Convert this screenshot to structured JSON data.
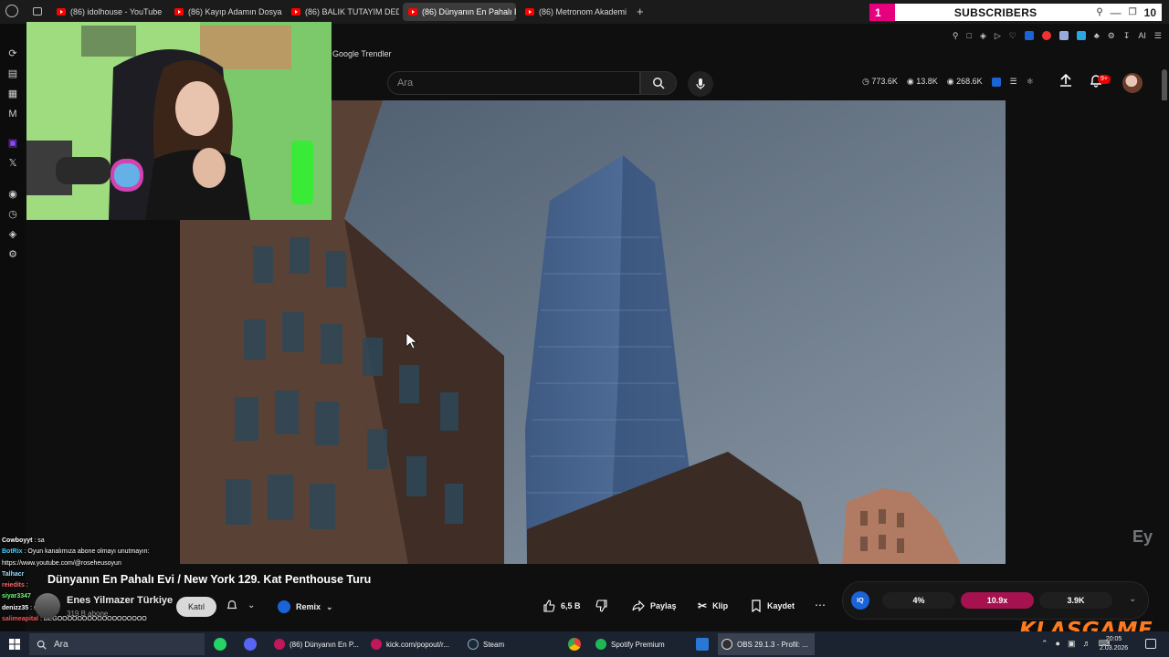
{
  "browser": {
    "tabs": [
      {
        "label": "(86) idolhouse - YouTube"
      },
      {
        "label": "(86) Kayıp Adamın Dosyası"
      },
      {
        "label": "(86) BALIK TUTAYIM DEDİ"
      },
      {
        "label": "(86) Dünyanın En Pahalı E"
      },
      {
        "label": "(86) Metronom Akademi"
      }
    ],
    "new_tab": "+"
  },
  "subscribers_widget": {
    "count": "1",
    "label": "SUBSCRIBERS",
    "right_value": "10"
  },
  "youtube": {
    "trendler": "Google Trendler",
    "search_placeholder": "Ara",
    "stats": [
      "773.6K",
      "13.8K",
      "268.6K"
    ],
    "notifications_badge": "9+"
  },
  "chat": [
    {
      "user": "Cowboyyt",
      "text": " : sa"
    },
    {
      "user": "BotRix",
      "text": " : Oyun kanalımıza abone olmayı unutmayın:"
    },
    {
      "user": "",
      "text": "https://www.youtube.com/@roseheusoyun"
    },
    {
      "user": "Talhacr",
      "text": ""
    },
    {
      "user": "reiedits",
      "text": " :"
    },
    {
      "user": "siyar3347",
      "text": ""
    },
    {
      "user": "denizz35",
      "text": " : sa"
    },
    {
      "user": "salimeapital",
      "text": " : BEGOOOOOOOOOOOOOOOOOO"
    }
  ],
  "video": {
    "title": "Dünyanın En Pahalı Evi / New York 129. Kat Penthouse Turu",
    "watermark": "Ey"
  },
  "channel": {
    "name": "Enes Yilmazer Türkiye",
    "subs": "319 B abone",
    "join": "Katıl",
    "remix": "Remix"
  },
  "actions": {
    "likes": "6,5 B",
    "share": "Paylaş",
    "clip": "Klip",
    "save": "Kaydet"
  },
  "stats_widget": {
    "badge": "IQ",
    "percent": "4%",
    "multiplier": "10.9x",
    "count": "3.9K"
  },
  "brand": {
    "logo_text": "KLASGAME"
  },
  "taskbar": {
    "search": "Ara",
    "items": [
      {
        "label": "(86) Dünyanın En P..."
      },
      {
        "label": "kick.com/popout/r..."
      },
      {
        "label": "Steam"
      },
      {
        "label": "Spotify Premium"
      },
      {
        "label": "OBS 29.1.3 - Profil: ..."
      }
    ],
    "time": "20:05",
    "date": "2.03.2026"
  },
  "colors": {
    "accent_pink": "#e6007e",
    "youtube_red": "#ff0000",
    "klasgame_orange": "#ff7a1f",
    "iq_blue": "#1a64d8"
  }
}
